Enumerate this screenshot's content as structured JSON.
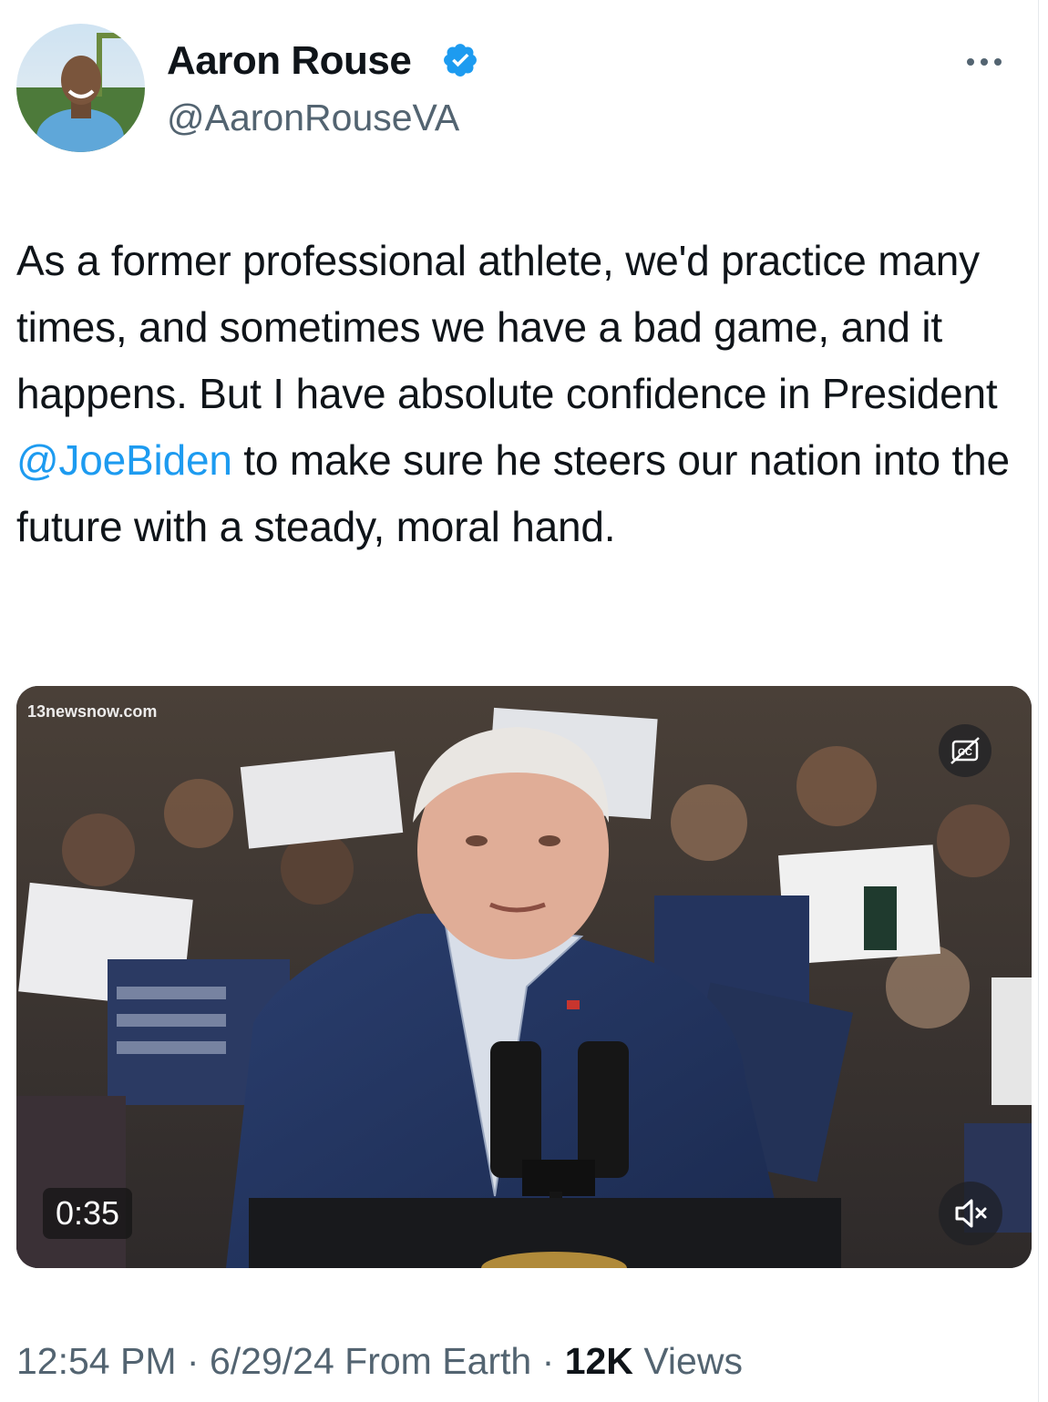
{
  "author": {
    "name": "Aaron Rouse",
    "handle": "@AaronRouseVA",
    "avatar_icon": "profile-photo",
    "verified_icon": "verified-badge-icon",
    "verified_color": "#1d9bf0"
  },
  "more_icon": "more-options-icon",
  "tweet": {
    "text_before": "As a former professional athlete, we'd practice many times, and sometimes we have a bad game, and it happens. But I have absolute confidence in President ",
    "mention": "@JoeBiden",
    "text_after": " to make sure he steers our nation into the future with a steady, moral hand.",
    "mention_color": "#1d9bf0"
  },
  "media": {
    "type": "video",
    "watermark": "13newsnow.com",
    "duration": "0:35",
    "captions_icon": "closed-captions-icon",
    "mute_icon": "muted-speaker-icon"
  },
  "meta": {
    "time": "12:54 PM",
    "date": "6/29/24",
    "source": "From Earth",
    "views_count": "12K",
    "views_label": "Views",
    "separator": "·"
  }
}
